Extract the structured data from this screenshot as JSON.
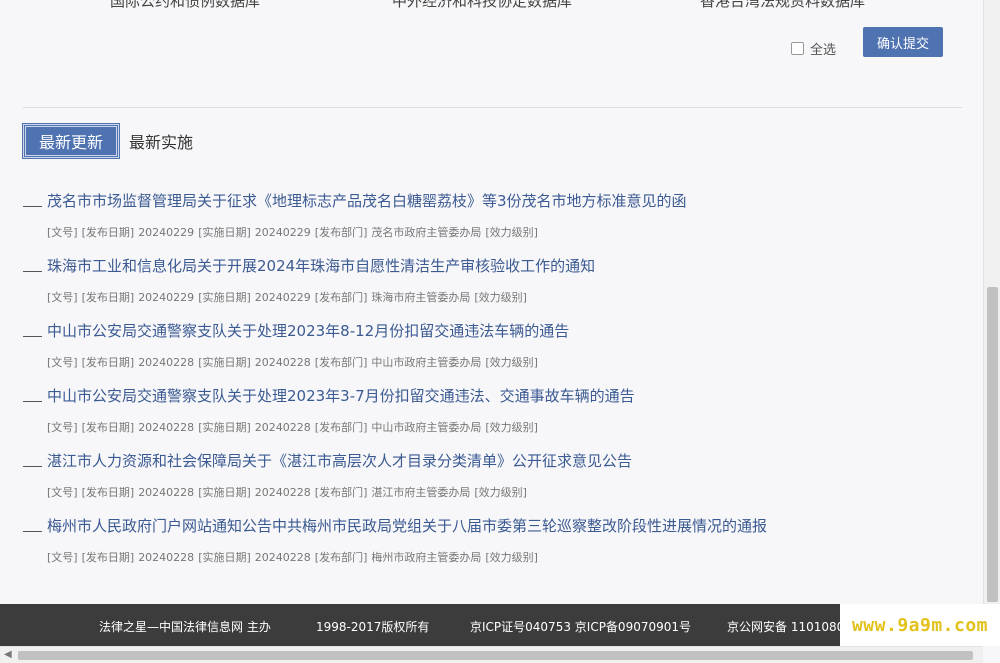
{
  "databases": [
    "国际公约和惯例数据库",
    "中外经济和科技协定数据库",
    "香港台湾法规资料数据库"
  ],
  "select_all_label": "全选",
  "submit_label": "确认提交",
  "tabs": [
    "最新更新",
    "最新实施"
  ],
  "meta_labels": {
    "doc_no": "[文号]",
    "publish_date": "[发布日期]",
    "effective_date": "[实施日期]",
    "department": "[发布部门]",
    "level": "[效力级别]"
  },
  "news": [
    {
      "title": "茂名市市场监督管理局关于征求《地理标志产品茂名白糖罂荔枝》等3份茂名市地方标准意见的函",
      "publish_date": "20240229",
      "effective_date": "20240229",
      "department": "茂名市政府主管委办局"
    },
    {
      "title": "珠海市工业和信息化局关于开展2024年珠海市自愿性清洁生产审核验收工作的通知",
      "publish_date": "20240229",
      "effective_date": "20240229",
      "department": "珠海市府主管委办局"
    },
    {
      "title": "中山市公安局交通警察支队关于处理2023年8-12月份扣留交通违法车辆的通告",
      "publish_date": "20240228",
      "effective_date": "20240228",
      "department": "中山市政府主管委办局"
    },
    {
      "title": "中山市公安局交通警察支队关于处理2023年3-7月份扣留交通违法、交通事故车辆的通告",
      "publish_date": "20240228",
      "effective_date": "20240228",
      "department": "中山市政府主管委办局"
    },
    {
      "title": "湛江市人力资源和社会保障局关于《湛江市高层次人才目录分类清单》公开征求意见公告",
      "publish_date": "20240228",
      "effective_date": "20240228",
      "department": "湛江市府主管委办局"
    },
    {
      "title": "梅州市人民政府门户网站通知公告中共梅州市民政局党组关于八届市委第三轮巡察整改阶段性进展情况的通报",
      "publish_date": "20240228",
      "effective_date": "20240228",
      "department": "梅州市政府主管委办局"
    }
  ],
  "footer": [
    "法律之星—中国法律信息网 主办",
    "1998-2017版权所有",
    "京ICP证号040753 京ICP备09070901号",
    "京公网安备 1101080"
  ],
  "watermark": "www.9a9m.com"
}
